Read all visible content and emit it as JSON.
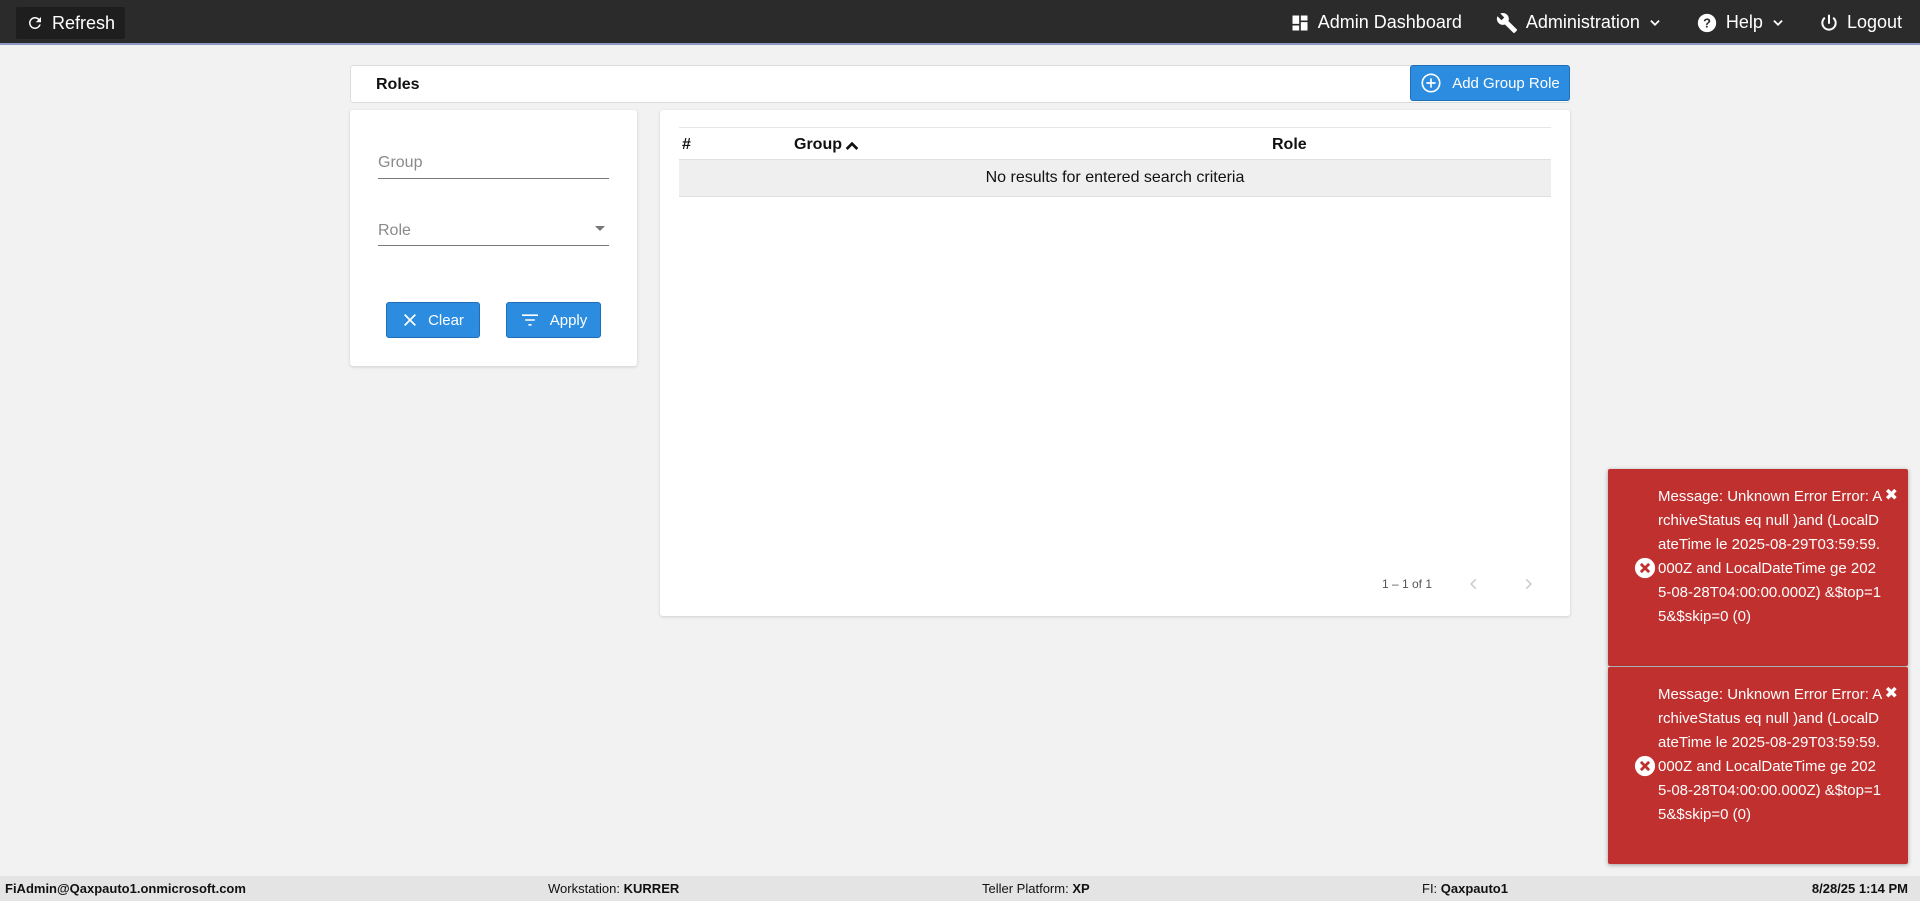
{
  "topbar": {
    "refresh_label": "Refresh",
    "nav": {
      "dashboard": "Admin Dashboard",
      "administration": "Administration",
      "help": "Help",
      "logout": "Logout"
    }
  },
  "page": {
    "title": "Roles",
    "add_button": "Add Group Role"
  },
  "filters": {
    "group_placeholder": "Group",
    "role_placeholder": "Role",
    "clear_label": "Clear",
    "apply_label": "Apply"
  },
  "table": {
    "columns": [
      "#",
      "Group",
      "Role"
    ],
    "empty_message": "No results for entered search criteria",
    "pagination": "1 – 1 of 1"
  },
  "toasts": [
    {
      "message": "Message: Unknown Error Error: ArchiveStatus eq null )and (LocalDateTime le 2025-08-29T03:59:59.000Z and LocalDateTime ge 2025-08-28T04:00:00.000Z) &$top=15&$skip=0 (0)"
    },
    {
      "message": "Message: Unknown Error Error: ArchiveStatus eq null )and (LocalDateTime le 2025-08-29T03:59:59.000Z and LocalDateTime ge 2025-08-28T04:00:00.000Z) &$top=15&$skip=0 (0)"
    }
  ],
  "status": {
    "user": "FiAdmin@Qaxpauto1.onmicrosoft.com",
    "workstation_label": "Workstation:",
    "workstation_value": "KURRER",
    "platform_label": "Teller Platform:",
    "platform_value": "XP",
    "fi_label": "FI:",
    "fi_value": "Qaxpauto1",
    "datetime": "8/28/25 1:14 PM"
  },
  "colors": {
    "topbar": "#2b2b2b",
    "primary": "#2b8ce0",
    "toast_error": "#c0302e"
  }
}
